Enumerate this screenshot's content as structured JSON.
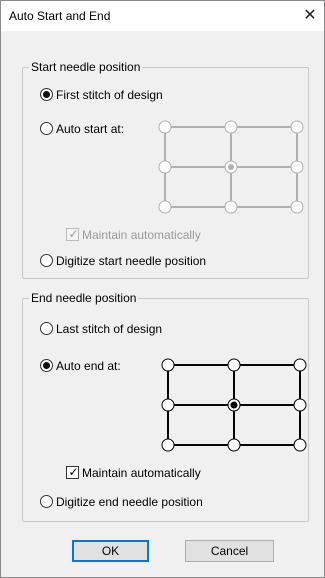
{
  "window": {
    "title": "Auto Start and End",
    "close_glyph": "✕"
  },
  "start_group": {
    "legend": "Start needle position",
    "first_stitch_label": "First stitch of design",
    "auto_start_label": "Auto start at:",
    "maintain_label": "Maintain automatically",
    "maintain_checked": true,
    "maintain_enabled": false,
    "digitize_label": "Digitize start needle position",
    "selected_option": "first_stitch",
    "grid_enabled": false,
    "grid_selected": "center"
  },
  "end_group": {
    "legend": "End needle position",
    "last_stitch_label": "Last stitch of design",
    "auto_end_label": "Auto end at:",
    "maintain_label": "Maintain automatically",
    "maintain_checked": true,
    "maintain_enabled": true,
    "digitize_label": "Digitize end needle position",
    "selected_option": "auto_end",
    "grid_enabled": true,
    "grid_selected": "center"
  },
  "buttons": {
    "ok_label": "OK",
    "cancel_label": "Cancel"
  },
  "colors": {
    "accent": "#0078d7",
    "disabled": "#9a9a9a"
  }
}
